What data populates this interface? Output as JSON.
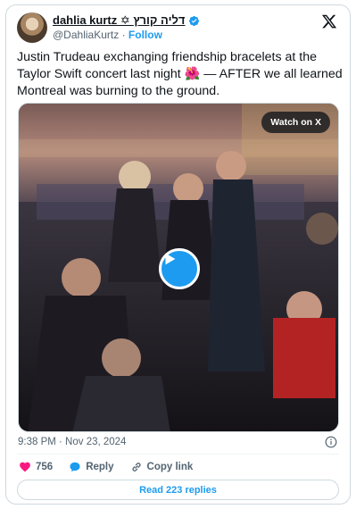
{
  "author": {
    "display_name": "dahlia kurtz ✡ דליה קורץ",
    "handle": "@DahliaKurtz",
    "separator": "·",
    "follow_label": "Follow"
  },
  "tweet": {
    "text_before_emoji": "Justin Trudeau exchanging friendship bracelets at the Taylor Swift concert last night ",
    "emoji": "🌺",
    "text_after_emoji": " — AFTER we all learned Montreal was burning to the ground."
  },
  "media": {
    "watch_label": "Watch on X"
  },
  "meta": {
    "timestamp": "9:38 PM · Nov 23, 2024"
  },
  "actions": {
    "like_count": "756",
    "reply_label": "Reply",
    "copy_link_label": "Copy link"
  },
  "read_replies_label": "Read 223 replies",
  "colors": {
    "brand_blue": "#1d9bf0",
    "like_red": "#f91880",
    "muted_text": "#536471",
    "border": "#cfd9de"
  },
  "icons": [
    "verified-badge-icon",
    "x-logo-icon",
    "play-icon",
    "info-icon",
    "heart-icon",
    "reply-bubble-icon",
    "link-icon"
  ]
}
